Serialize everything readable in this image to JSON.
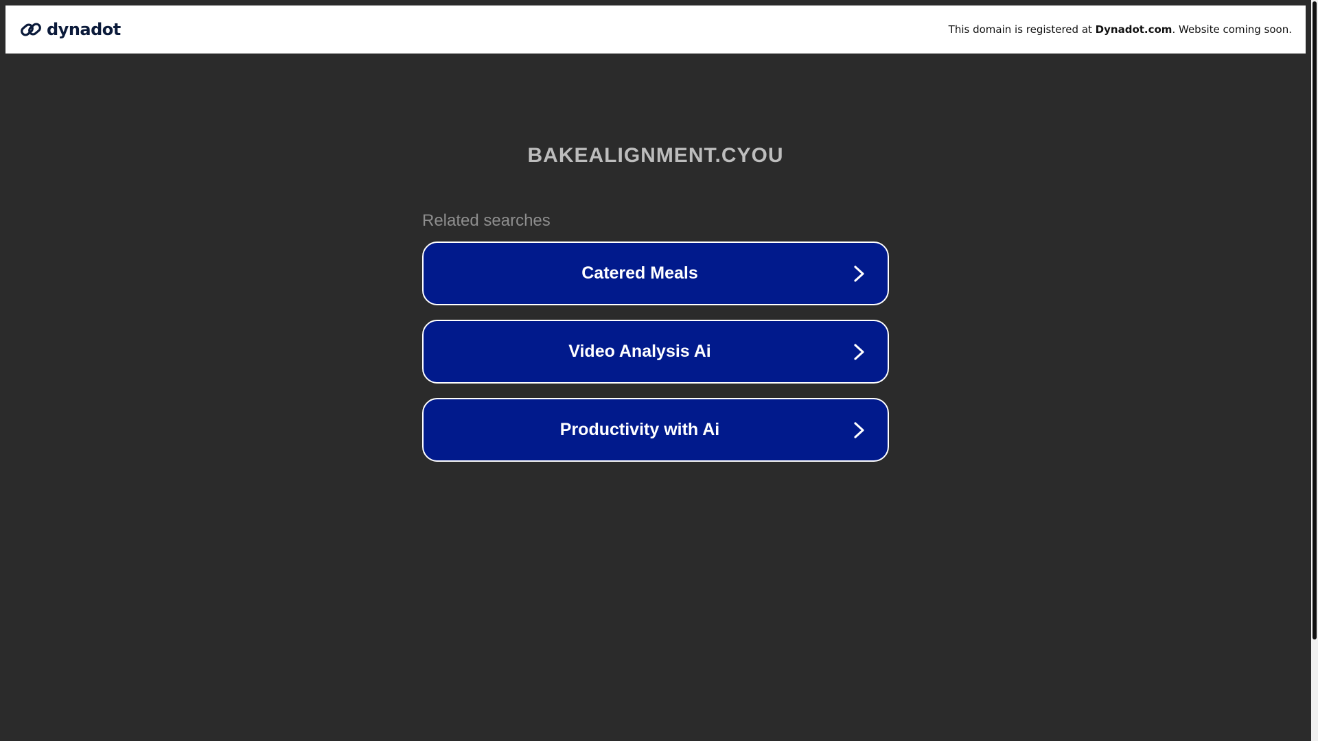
{
  "header": {
    "brand_name": "dynadot",
    "brand_icon": "dynadot-logo-icon",
    "notice_prefix": "This domain is registered at ",
    "notice_link": "Dynadot.com",
    "notice_suffix": ". Website coming soon."
  },
  "main": {
    "domain": "BAKEALIGNMENT.CYOU",
    "related_heading": "Related searches",
    "results": [
      {
        "label": "Catered Meals",
        "icon": "chevron-right-icon"
      },
      {
        "label": "Video Analysis Ai",
        "icon": "chevron-right-icon"
      },
      {
        "label": "Productivity with Ai",
        "icon": "chevron-right-icon"
      }
    ]
  },
  "colors": {
    "background": "#2b2b2b",
    "header_bg": "#ffffff",
    "button_bg": "#011a8c",
    "button_border": "#ffffff",
    "domain_text": "#bdbdbd",
    "related_text": "#8e8e8e"
  }
}
